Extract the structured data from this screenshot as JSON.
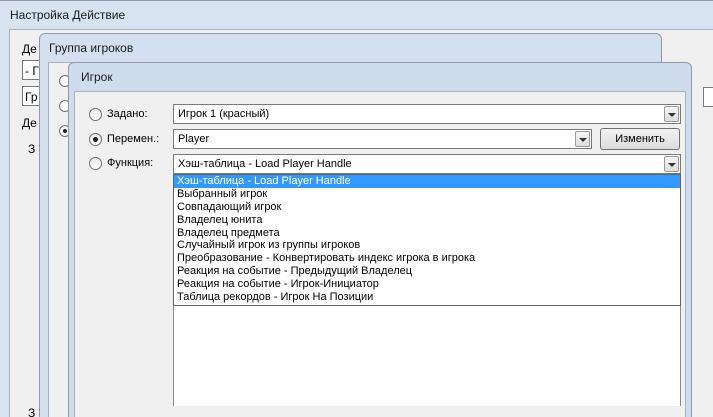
{
  "windows": {
    "trigger_action": {
      "title": "Настройка Действие",
      "fragments": [
        "Де",
        "- Г",
        "Гр",
        "Де",
        "З",
        "З"
      ]
    },
    "player_group": {
      "title": "Группа игроков"
    },
    "player": {
      "title": "Игрок",
      "options": {
        "preset": {
          "label": "Задано:",
          "value": "Игрок 1 (красный)",
          "selected": false
        },
        "variable": {
          "label": "Перемен.:",
          "value": "Player",
          "selected": true,
          "button": "Изменить"
        },
        "function": {
          "label": "Функция:",
          "value": "Хэш-таблица - Load Player Handle",
          "selected": false
        }
      },
      "dropdown": {
        "items": [
          "Хэш-таблица - Load Player Handle",
          "Выбранный игрок",
          "Совпадающий игрок",
          "Владелец юнита",
          "Владелец предмета",
          "Случайный игрок из группы игроков",
          "Преобразование - Конвертировать индекс игрока в игрока",
          "Реакция на событие - Предыдущий Владелец",
          "Реакция на событие - Игрок-Инициатор",
          "Таблица рекордов - Игрок На Позиции"
        ],
        "highlighted_index": 0
      }
    }
  },
  "colors": {
    "highlight": "#3399ff",
    "title_bar": "#c9d8ea",
    "client": "#f0f0f0"
  }
}
